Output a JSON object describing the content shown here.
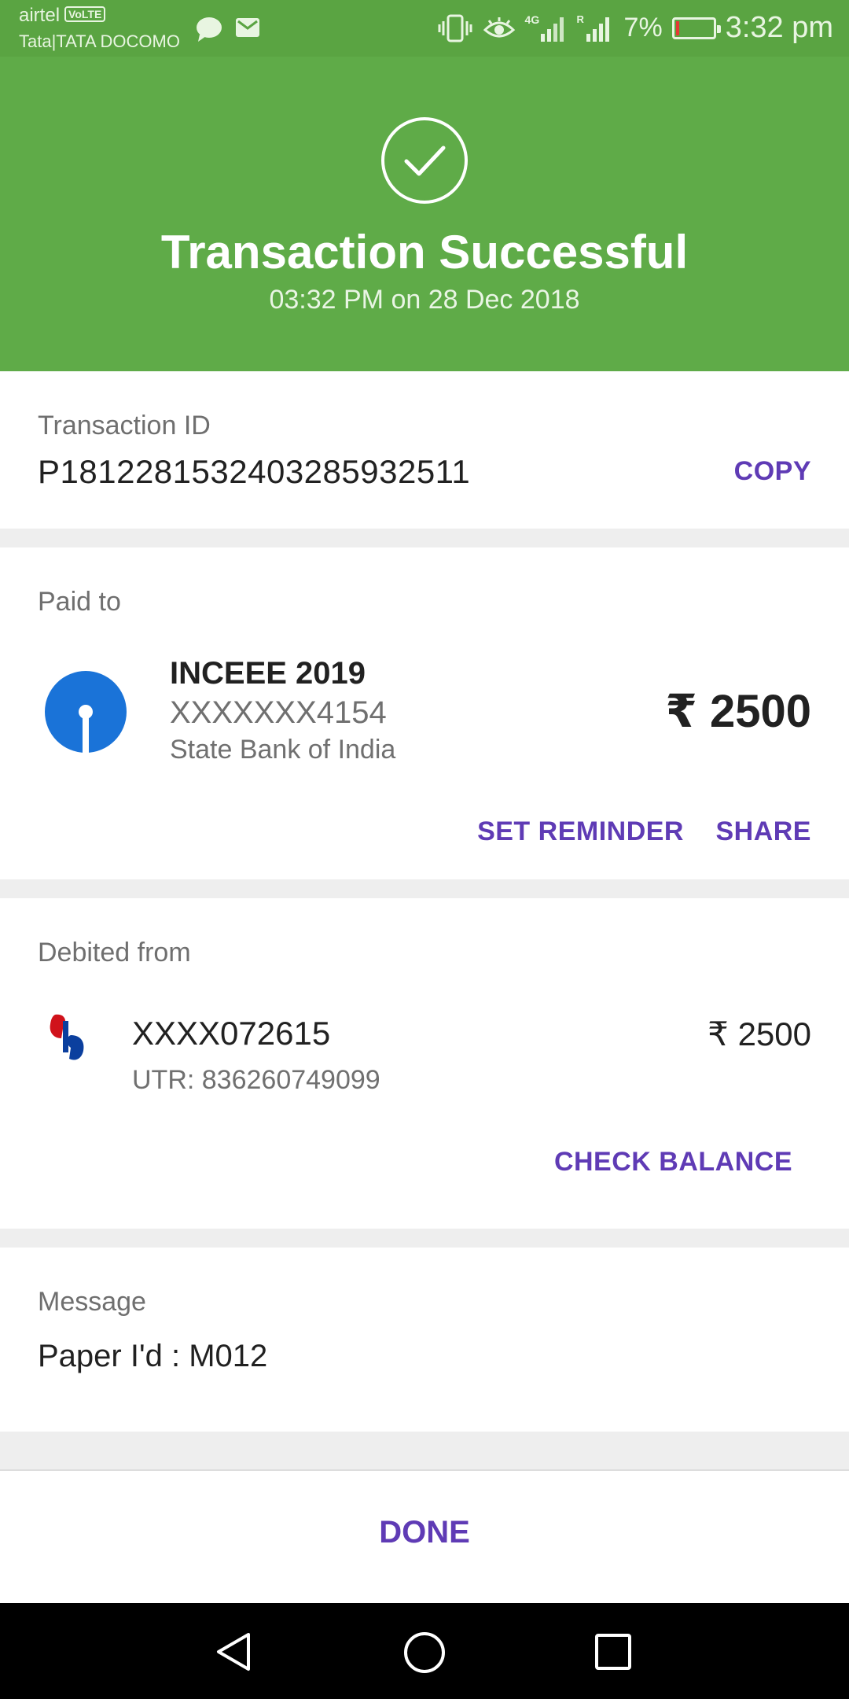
{
  "status_bar": {
    "carrier1": "airtel",
    "volte": "VoLTE",
    "carrier2": "Tata|TATA DOCOMO",
    "network_label": "4G",
    "roaming_label": "R",
    "battery_percent": "7%",
    "battery_level": 0.07,
    "time": "3:32 pm",
    "icons": [
      "chat-icon",
      "mail-icon",
      "vibrate-icon",
      "eye-comfort-icon",
      "signal-icon",
      "signal-icon",
      "battery-icon"
    ]
  },
  "header": {
    "title": "Transaction Successful",
    "subtitle": "03:32 PM on 28 Dec 2018",
    "icon": "check-circle-icon",
    "color": "#5fab48"
  },
  "transaction": {
    "label": "Transaction ID",
    "id": "P1812281532403285932511",
    "copy_label": "COPY"
  },
  "paid_to": {
    "label": "Paid to",
    "name": "INCEEE 2019",
    "account": "XXXXXXX4154",
    "bank": "State Bank of India",
    "amount": "₹ 2500",
    "set_reminder_label": "SET REMINDER",
    "share_label": "SHARE",
    "logo": "sbi-logo-icon"
  },
  "debited_from": {
    "label": "Debited from",
    "account": "XXXX072615",
    "utr": "UTR: 836260749099",
    "amount": "₹ 2500",
    "check_balance_label": "CHECK BALANCE",
    "logo": "bank-logo-icon"
  },
  "message": {
    "label": "Message",
    "text": "Paper I'd : M012"
  },
  "done_label": "DONE",
  "nav": {
    "icons": [
      "back-icon",
      "home-icon",
      "recents-icon"
    ]
  },
  "colors": {
    "accent": "#5f3bb5",
    "success_green": "#5fab48",
    "status_bar": "#5aa442"
  }
}
